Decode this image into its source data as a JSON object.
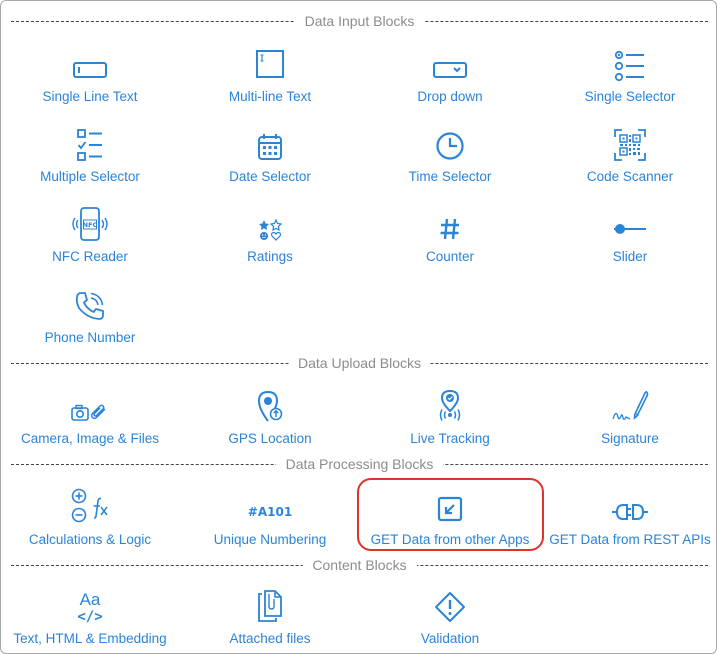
{
  "sections": {
    "input": "Data Input Blocks",
    "upload": "Data Upload Blocks",
    "processing": "Data Processing Blocks",
    "content": "Content Blocks"
  },
  "blocks": {
    "single_line_text": "Single Line Text",
    "multi_line_text": "Multi-line Text",
    "drop_down": "Drop down",
    "single_selector": "Single Selector",
    "multiple_selector": "Multiple Selector",
    "date_selector": "Date Selector",
    "time_selector": "Time Selector",
    "code_scanner": "Code Scanner",
    "nfc_reader": "NFC Reader",
    "ratings": "Ratings",
    "counter": "Counter",
    "slider": "Slider",
    "phone_number": "Phone Number",
    "camera_image_files": "Camera, Image & Files",
    "gps_location": "GPS Location",
    "live_tracking": "Live Tracking",
    "signature": "Signature",
    "calculations_logic": "Calculations & Logic",
    "unique_numbering": "Unique Numbering",
    "get_data_other_apps": "GET Data from other Apps",
    "get_data_rest_apis": "GET Data from REST APIs",
    "text_html_embedding": "Text, HTML & Embedding",
    "attached_files": "Attached files",
    "validation": "Validation"
  },
  "icon_text": {
    "nfc": "NFC",
    "numbering": "#A101",
    "aa": "Aa",
    "code": "</>",
    "hash": "#"
  },
  "colors": {
    "accent": "#2a84d8",
    "section_title": "#8c8c8c",
    "highlight": "#e0312b"
  }
}
